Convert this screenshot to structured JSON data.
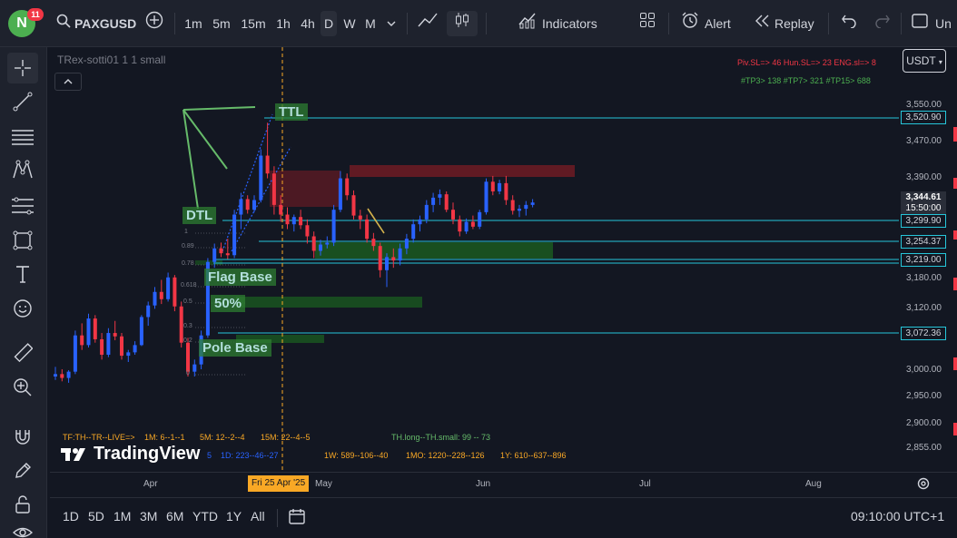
{
  "toolbar": {
    "avatar_letter": "N",
    "avatar_badge": "11",
    "symbol": "PAXGUSD",
    "intervals": [
      "1m",
      "5m",
      "15m",
      "1h",
      "4h",
      "D",
      "W",
      "M"
    ],
    "active_interval": "D",
    "indicators_label": "Indicators",
    "alert_label": "Alert",
    "replay_label": "Replay",
    "right_cut_label": "Un"
  },
  "legend": {
    "title": "TRex-sotti01 1 1 small",
    "stats_line1": "Piv.SL=> 46  Hun.SL=> 23  ENG.sl=> 8",
    "stats_line2": "#TP3> 138  #TP7> 321  #TP15> 688"
  },
  "currency": "USDT",
  "y_axis": {
    "ticks": [
      "3,550.00",
      "3,470.00",
      "3,390.00",
      "3,180.00",
      "3,120.00",
      "3,000.00",
      "2,950.00",
      "2,900.00",
      "2,855.00"
    ],
    "price_tags": [
      "3,520.90",
      "3,299.90",
      "3,254.37",
      "3,219.00",
      "3,072.36"
    ],
    "current_price": "3,344.61",
    "countdown": "15:50:00"
  },
  "x_axis": {
    "labels": [
      "Apr",
      "May",
      "Jun",
      "Jul",
      "Aug"
    ],
    "crosshair_label": "Fri 25 Apr '25"
  },
  "annotations": {
    "ttl": "TTL",
    "dtl": "DTL",
    "flag_base": "Flag Base",
    "fifty": "50%",
    "pole_base": "Pole Base"
  },
  "fib_levels": [
    "1",
    "0.89",
    "0.78",
    "0.618",
    "0.5",
    "0.3",
    "0.2",
    "0"
  ],
  "info_lines": {
    "tf": "TF:TH--TR--LIVE=>",
    "m1": "1M: 6--1--1",
    "m5": "5M: 12--2--4",
    "m15": "15M: 22--4--5",
    "th": "TH.long--TH.small: 99 -- 73",
    "d1": "1D: 223--46--27",
    "w1": "1W: 589--106--40",
    "mo1": "1MO: 1220--228--126",
    "y1": "1Y: 610--637--896",
    "d1_prefix": "5"
  },
  "watermark": "TradingView",
  "bottom": {
    "ranges": [
      "1D",
      "5D",
      "1M",
      "3M",
      "6M",
      "YTD",
      "1Y",
      "All"
    ],
    "clock": "09:10:00 UTC+1"
  },
  "colors": {
    "up": "#2962ff",
    "down": "#f23645",
    "line": "#26c6da",
    "green_box": "#2e7d32",
    "red_box": "#b71c1c",
    "crosshair": "#f9a825"
  },
  "candles": [
    [
      2985,
      3005,
      2978,
      2990
    ],
    [
      2990,
      3000,
      2975,
      2982
    ],
    [
      2982,
      2998,
      2972,
      2995
    ],
    [
      2995,
      3080,
      2990,
      3070
    ],
    [
      3070,
      3095,
      3040,
      3050
    ],
    [
      3050,
      3115,
      3045,
      3105
    ],
    [
      3105,
      3112,
      3055,
      3062
    ],
    [
      3062,
      3075,
      3020,
      3030
    ],
    [
      3030,
      3085,
      3025,
      3075
    ],
    [
      3075,
      3100,
      3060,
      3068
    ],
    [
      3068,
      3075,
      3020,
      3028
    ],
    [
      3028,
      3040,
      3015,
      3035
    ],
    [
      3035,
      3058,
      3030,
      3050
    ],
    [
      3050,
      3112,
      3048,
      3108
    ],
    [
      3108,
      3140,
      3090,
      3132
    ],
    [
      3132,
      3170,
      3125,
      3160
    ],
    [
      3160,
      3185,
      3135,
      3145
    ],
    [
      3145,
      3200,
      3140,
      3190
    ],
    [
      3190,
      3195,
      3120,
      3130
    ],
    [
      3130,
      3140,
      3045,
      3055
    ],
    [
      3055,
      3065,
      2985,
      2995
    ],
    [
      2995,
      3020,
      2985,
      3010
    ],
    [
      3010,
      3080,
      3000,
      3070
    ],
    [
      3070,
      3230,
      3065,
      3222
    ],
    [
      3222,
      3260,
      3210,
      3250
    ],
    [
      3250,
      3262,
      3232,
      3240
    ],
    [
      3240,
      3270,
      3228,
      3236
    ],
    [
      3236,
      3330,
      3230,
      3320
    ],
    [
      3320,
      3365,
      3290,
      3352
    ],
    [
      3352,
      3360,
      3322,
      3330
    ],
    [
      3330,
      3360,
      3325,
      3350
    ],
    [
      3350,
      3455,
      3345,
      3442
    ],
    [
      3442,
      3510,
      3395,
      3405
    ],
    [
      3405,
      3420,
      3320,
      3340
    ],
    [
      3340,
      3360,
      3305,
      3320
    ],
    [
      3320,
      3335,
      3290,
      3300
    ],
    [
      3300,
      3320,
      3285,
      3315
    ],
    [
      3315,
      3330,
      3290,
      3298
    ],
    [
      3298,
      3310,
      3260,
      3275
    ],
    [
      3275,
      3285,
      3230,
      3245
    ],
    [
      3245,
      3268,
      3235,
      3258
    ],
    [
      3258,
      3275,
      3250,
      3262
    ],
    [
      3262,
      3340,
      3255,
      3330
    ],
    [
      3330,
      3410,
      3325,
      3395
    ],
    [
      3395,
      3405,
      3350,
      3360
    ],
    [
      3360,
      3370,
      3310,
      3318
    ],
    [
      3318,
      3330,
      3290,
      3310
    ],
    [
      3310,
      3320,
      3262,
      3270
    ],
    [
      3270,
      3282,
      3245,
      3255
    ],
    [
      3255,
      3262,
      3190,
      3205
    ],
    [
      3205,
      3240,
      3170,
      3232
    ],
    [
      3232,
      3250,
      3210,
      3225
    ],
    [
      3225,
      3260,
      3215,
      3250
    ],
    [
      3250,
      3280,
      3238,
      3270
    ],
    [
      3270,
      3310,
      3262,
      3300
    ],
    [
      3300,
      3318,
      3285,
      3310
    ],
    [
      3310,
      3350,
      3302,
      3340
    ],
    [
      3340,
      3365,
      3325,
      3355
    ],
    [
      3355,
      3372,
      3340,
      3362
    ],
    [
      3362,
      3368,
      3325,
      3330
    ],
    [
      3330,
      3345,
      3300,
      3310
    ],
    [
      3310,
      3318,
      3275,
      3285
    ],
    [
      3285,
      3312,
      3280,
      3305
    ],
    [
      3305,
      3318,
      3290,
      3295
    ],
    [
      3295,
      3330,
      3290,
      3325
    ],
    [
      3325,
      3395,
      3320,
      3388
    ],
    [
      3388,
      3400,
      3360,
      3368
    ],
    [
      3368,
      3392,
      3362,
      3385
    ],
    [
      3385,
      3400,
      3340,
      3350
    ],
    [
      3350,
      3360,
      3320,
      3328
    ],
    [
      3328,
      3340,
      3315,
      3332
    ],
    [
      3332,
      3348,
      3318,
      3340
    ],
    [
      3340,
      3352,
      3335,
      3345
    ]
  ]
}
